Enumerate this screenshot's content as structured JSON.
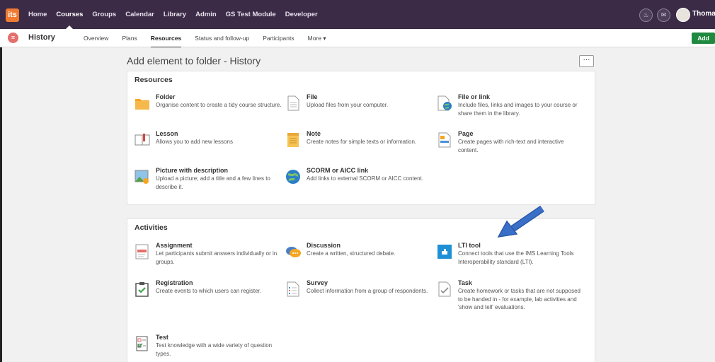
{
  "topbar": {
    "logo": "its",
    "nav": [
      "Home",
      "Courses",
      "Groups",
      "Calendar",
      "Library",
      "Admin",
      "GS Test Module",
      "Developer"
    ],
    "active_index": 1,
    "user": "Thomas",
    "icons": [
      "bell-icon",
      "mail-icon"
    ]
  },
  "subbar": {
    "course": "History",
    "tabs": [
      "Overview",
      "Plans",
      "Resources",
      "Status and follow-up",
      "Participants",
      "More ▾"
    ],
    "active_index": 2,
    "add_label": "Add"
  },
  "page": {
    "title": "Add element to folder - History",
    "more_label": "···"
  },
  "resources": {
    "heading": "Resources",
    "items": [
      {
        "title": "Folder",
        "desc": "Organise content to create a tidy course structure."
      },
      {
        "title": "File",
        "desc": "Upload files from your computer."
      },
      {
        "title": "File or link",
        "desc": "Include files, links and images to your course or share them in the library."
      },
      {
        "title": "Lesson",
        "desc": "Allows you to add new lessons"
      },
      {
        "title": "Note",
        "desc": "Create notes for simple texts or information."
      },
      {
        "title": "Page",
        "desc": "Create pages with rich-text and interactive content."
      },
      {
        "title": "Picture with description",
        "desc": "Upload a picture; add a title and a few lines to describe it."
      },
      {
        "title": "SCORM or AICC link",
        "desc": "Add links to external SCORM or AICC content."
      }
    ]
  },
  "activities": {
    "heading": "Activities",
    "items": [
      {
        "title": "Assignment",
        "desc": "Let participants submit answers individually or in groups."
      },
      {
        "title": "Discussion",
        "desc": "Create a written, structured debate."
      },
      {
        "title": "LTI tool",
        "desc": "Connect tools that use the IMS Learning Tools Interoperability standard (LTI)."
      },
      {
        "title": "Registration",
        "desc": "Create events to which users can register."
      },
      {
        "title": "Survey",
        "desc": "Collect information from a group of respondents."
      },
      {
        "title": "Task",
        "desc": "Create homework or tasks that are not supposed to be handed in - for example, lab activities and 'show and tell' evaluations."
      },
      {
        "title": "Test",
        "desc": "Test knowledge with a wide variety of question types."
      }
    ]
  },
  "colors": {
    "topbar": "#3b2b47",
    "add_button": "#1f8a3f",
    "arrow": "#3a6fc9"
  }
}
